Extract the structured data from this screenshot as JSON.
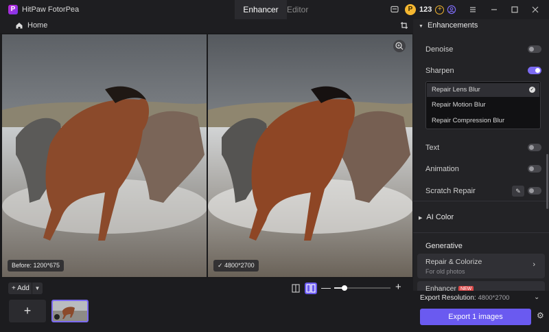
{
  "app": {
    "title": "HitPaw FotorPea",
    "logo_letter": "P"
  },
  "tabs": [
    {
      "label": "Enhancer",
      "active": true
    },
    {
      "label": "Editor",
      "active": false
    }
  ],
  "credits": {
    "count": "123"
  },
  "breadcrumb": {
    "home_label": "Home"
  },
  "images": {
    "before_badge": "Before: 1200*675",
    "after_badge": "4800*2700"
  },
  "bottom": {
    "add_label": "Add",
    "zoom_level_fraction": 0.18
  },
  "panel": {
    "enhancements_title": "Enhancements",
    "denoise_label": "Denoise",
    "sharpen_label": "Sharpen",
    "sharpen_options": [
      "Repair Lens Blur",
      "Repair Motion Blur",
      "Repair Compression Blur"
    ],
    "sharpen_selected": "Repair Lens Blur",
    "text_label": "Text",
    "animation_label": "Animation",
    "scratch_label": "Scratch Repair",
    "ai_color_title": "AI Color",
    "generative_title": "Generative",
    "repair_colorize_title": "Repair & Colorize",
    "repair_colorize_sub": "For old photos",
    "enhancer_title": "Enhancer",
    "new_tag": "NEW",
    "export_resolution_label": "Export Resolution:",
    "export_resolution_value": "4800*2700",
    "export_button": "Export 1 images"
  },
  "colors": {
    "accent": "#6a5af0",
    "panel_bg": "#232326",
    "coin": "#f5b731"
  }
}
